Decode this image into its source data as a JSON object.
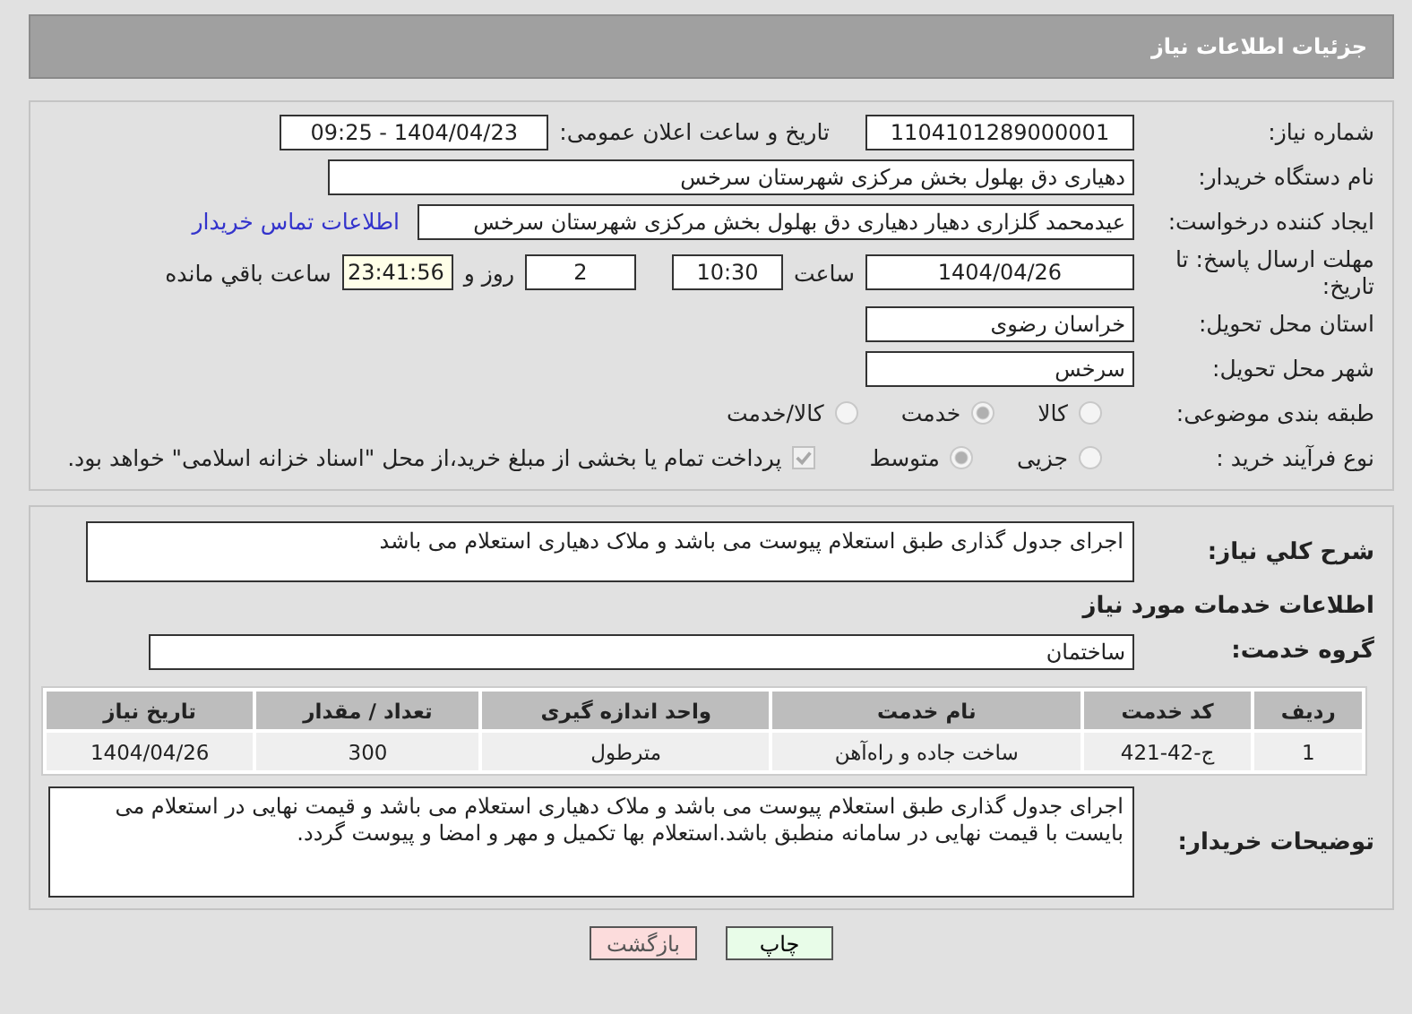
{
  "header": {
    "title": "جزئیات اطلاعات نیاز"
  },
  "need_number": {
    "label": "شماره نیاز:",
    "value": "1104101289000001"
  },
  "announce": {
    "label": "تاریخ و ساعت اعلان عمومی:",
    "value": "1404/04/23 - 09:25"
  },
  "buyer_org": {
    "label": "نام دستگاه خریدار:",
    "value": "دهیاری دق بهلول بخش مرکزی شهرستان سرخس"
  },
  "creator": {
    "label": "ایجاد کننده درخواست:",
    "value": "عیدمحمد گلزاری دهیار دهیاری دق بهلول بخش مرکزی شهرستان سرخس",
    "link": "اطلاعات تماس خریدار"
  },
  "deadline": {
    "label": "مهلت ارسال پاسخ: تا تاریخ:",
    "date": "1404/04/26",
    "time_label": "ساعت",
    "time": "10:30",
    "days": "2",
    "days_label": "روز و",
    "remaining": "23:41:56",
    "remaining_label": "ساعت باقي مانده"
  },
  "province": {
    "label": "استان محل تحویل:",
    "value": "خراسان رضوی"
  },
  "city": {
    "label": "شهر محل تحویل:",
    "value": "سرخس"
  },
  "category": {
    "label": "طبقه بندی موضوعی:",
    "options": [
      {
        "label": "کالا",
        "selected": false
      },
      {
        "label": "خدمت",
        "selected": true
      },
      {
        "label": "کالا/خدمت",
        "selected": false
      }
    ]
  },
  "process": {
    "label": "نوع فرآیند خرید :",
    "options": [
      {
        "label": "جزیی",
        "selected": false
      },
      {
        "label": "متوسط",
        "selected": true
      }
    ],
    "payment": {
      "checked": true,
      "text": "پرداخت تمام یا بخشی از مبلغ خرید،از محل \"اسناد خزانه اسلامی\" خواهد بود."
    }
  },
  "description": {
    "label": "شرح کلي نياز:",
    "value": "اجرای جدول گذاری طبق استعلام پیوست می باشد و ملاک دهیاری استعلام می باشد"
  },
  "services_heading": "اطلاعات خدمات مورد نیاز",
  "service_group": {
    "label": "گروه خدمت:",
    "value": "ساختمان"
  },
  "table": {
    "columns": [
      "ردیف",
      "کد خدمت",
      "نام خدمت",
      "واحد اندازه گیری",
      "تعداد / مقدار",
      "تاریخ نیاز"
    ],
    "rows": [
      [
        "1",
        "ج-42-421",
        "ساخت جاده و راه‌آهن",
        "مترطول",
        "300",
        "1404/04/26"
      ]
    ]
  },
  "buyer_notes": {
    "label": "توضیحات خریدار:",
    "value": "اجرای جدول گذاری طبق استعلام پیوست می باشد و ملاک دهیاری استعلام می باشد و قیمت نهایی در استعلام می بایست با قیمت نهایی در سامانه منطبق باشد.استعلام بها تکمیل و مهر و امضا و پیوست گردد."
  },
  "buttons": [
    {
      "kind": "print",
      "label": "چاپ"
    },
    {
      "kind": "back",
      "label": "بازگشت"
    }
  ]
}
